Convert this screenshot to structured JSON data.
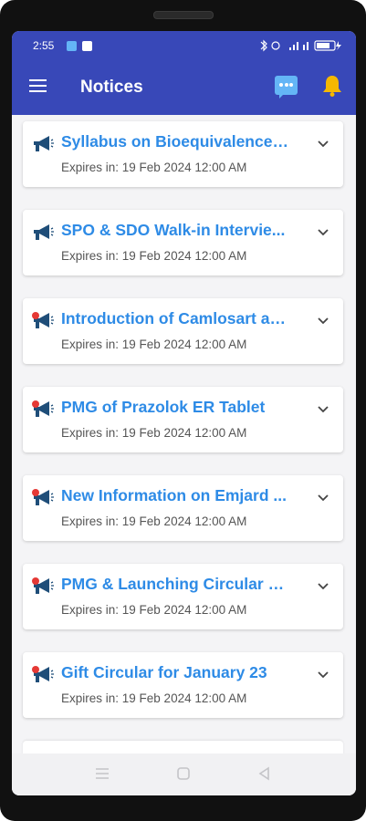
{
  "status_bar": {
    "time": "2:55",
    "right_icons": "∗ ⍝ Vol 4G ▭",
    "icons": [
      "app-notification-icon",
      "linkedin-icon",
      "bluetooth-icon",
      "alarm-icon",
      "signal-icon",
      "battery-icon"
    ]
  },
  "app_bar": {
    "title": "Notices",
    "icons": [
      "menu-icon",
      "chat-icon",
      "bell-icon"
    ]
  },
  "notices": [
    {
      "title": "Syllabus on Bioequivalence ...",
      "expires": "Expires in: 19 Feb 2024 12:00 AM",
      "icon": "megaphone-icon"
    },
    {
      "title": "SPO & SDO Walk-in Intervie...",
      "expires": "Expires in: 19 Feb 2024 12:00 AM",
      "icon": "megaphone-icon"
    },
    {
      "title": "Introduction of Camlosart as...",
      "expires": "Expires in: 19 Feb 2024 12:00 AM",
      "icon": "megaphone-alert-icon"
    },
    {
      "title": "PMG of Prazolok ER Tablet",
      "expires": "Expires in: 19 Feb 2024 12:00 AM",
      "icon": "megaphone-alert-icon"
    },
    {
      "title": "New Information on Emjard ...",
      "expires": "Expires in: 19 Feb 2024 12:00 AM",
      "icon": "megaphone-alert-icon"
    },
    {
      "title": "PMG & Launching Circular of...",
      "expires": "Expires in: 19 Feb 2024 12:00 AM",
      "icon": "megaphone-alert-icon"
    },
    {
      "title": "Gift Circular for January 23",
      "expires": "Expires in: 19 Feb 2024 12:00 AM",
      "icon": "megaphone-alert-icon"
    }
  ],
  "nav_bar": {
    "icons": [
      "recent-apps-icon",
      "home-icon",
      "back-icon"
    ]
  },
  "colors": {
    "app_bar": "#3848b8",
    "notice_title": "#2e8be6",
    "bell": "#f5b800",
    "chat": "#64b5f6",
    "background": "#f4f4f6"
  }
}
